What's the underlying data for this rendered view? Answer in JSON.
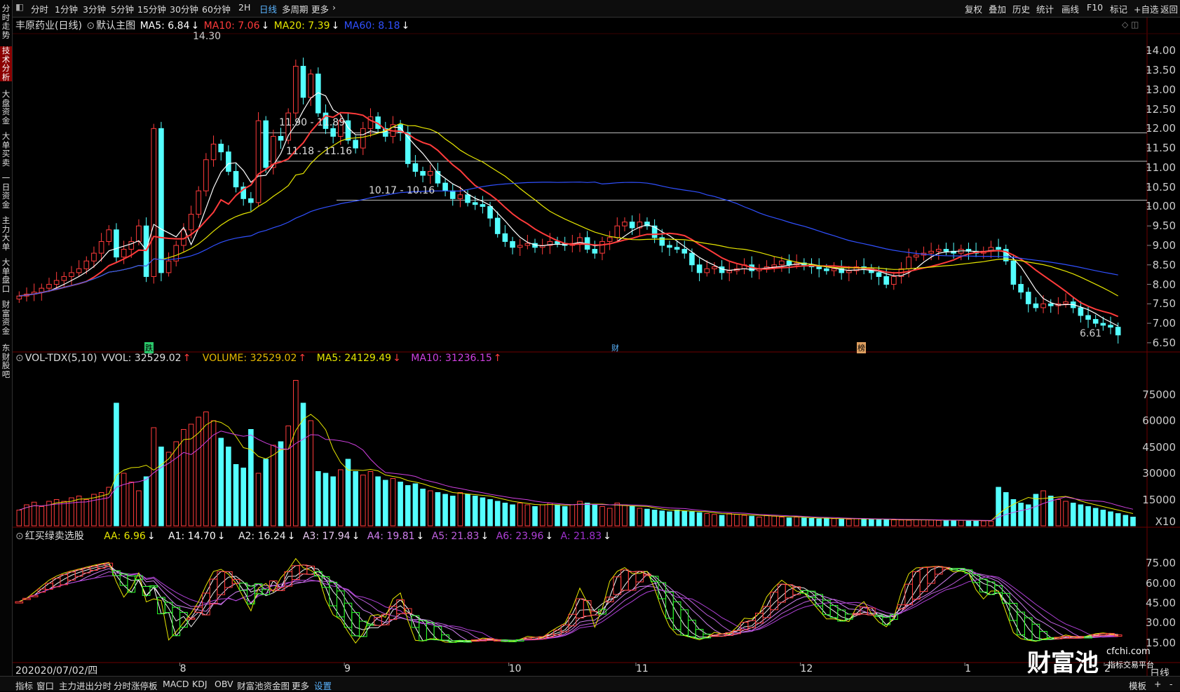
{
  "toolbar": {
    "periods": [
      "分时",
      "1分钟",
      "3分钟",
      "5分钟",
      "15分钟",
      "30分钟",
      "60分钟",
      "2H",
      "日线",
      "多周期",
      "更多"
    ],
    "active_period": "日线",
    "right_tools": [
      "复权",
      "叠加",
      "历史",
      "统计",
      "画线",
      "F10",
      "标记",
      "+自选",
      "返回"
    ]
  },
  "sidebar": {
    "tabs": [
      "分时走势",
      "技术分析",
      "大盘资金",
      "大单买卖",
      "一日资金",
      "主力大单",
      "大单盘口",
      "财富资金",
      "东财股吧"
    ],
    "active": "技术分析"
  },
  "main_header": {
    "title": "丰原药业(日线)",
    "template": "默认主图",
    "ma5": "MA5: 6.84",
    "ma10": "MA10: 7.06",
    "ma20": "MA20: 7.39",
    "ma60": "MA60: 8.18",
    "colors": {
      "ma5": "#ffffff",
      "ma10": "#ff3b3b",
      "ma20": "#e6e600",
      "ma60": "#3050ff"
    }
  },
  "price_axis": [
    "14.00",
    "13.50",
    "13.00",
    "12.50",
    "12.00",
    "11.50",
    "11.00",
    "10.50",
    "10.00",
    "9.50",
    "9.00",
    "8.50",
    "8.00",
    "7.50",
    "7.00",
    "6.50"
  ],
  "annotations": {
    "high": "14.30",
    "low": "6.61",
    "levels": [
      "11.90 - 11.89",
      "11.18 - 11.16",
      "10.17 - 10.16"
    ],
    "markers": [
      "跌",
      "财",
      "榜"
    ]
  },
  "volume_header": {
    "name": "VOL-TDX(5,10)",
    "vvol": "VVOL: 32529.02",
    "volume": "VOLUME: 32529.02",
    "ma5": "MA5: 24129.49",
    "ma10": "MA10: 31236.15"
  },
  "volume_axis": [
    "75000",
    "60000",
    "45000",
    "30000",
    "15000",
    "X10"
  ],
  "indicator_header": {
    "name": "红买绿卖选股",
    "aa": "AA: 6.96",
    "a1": "A1: 14.70",
    "a2": "A2: 16.24",
    "a3": "A3: 17.94",
    "a4": "A4: 19.81",
    "a5": "A5: 21.83",
    "a6": "A6: 23.96",
    "a": "A: 21.83"
  },
  "indicator_axis": [
    "75.00",
    "60.00",
    "45.00",
    "30.00",
    "15.00"
  ],
  "date_axis": {
    "start": "2020/07/02/四",
    "months": [
      "8",
      "9",
      "10",
      "11",
      "12",
      "1",
      "2"
    ]
  },
  "watermark": {
    "brand": "财富池",
    "url": "cfchi.com",
    "tagline": "指标交易平台"
  },
  "bottom_tabs": [
    "指标",
    "窗口",
    "主力进出分时",
    "分时涨停板",
    "MACD",
    "KDJ",
    "OBV",
    "财富池资金图",
    "更多",
    "设置"
  ],
  "bottom_right": [
    "模板",
    "+",
    "-"
  ],
  "period_label": "日线",
  "chart_data": {
    "type": "candlestick",
    "title": "丰原药业(日线)",
    "ylim": [
      6.3,
      14.4
    ],
    "month_ticks": [
      "8",
      "9",
      "10",
      "11",
      "12",
      "1",
      "2"
    ],
    "close": [
      7.7,
      7.75,
      7.8,
      7.9,
      8.0,
      8.1,
      8.2,
      8.3,
      8.4,
      8.6,
      8.8,
      9.1,
      9.4,
      8.7,
      8.9,
      9.1,
      9.5,
      8.2,
      12.0,
      8.3,
      8.6,
      9.0,
      9.4,
      9.8,
      10.4,
      11.2,
      11.6,
      11.4,
      10.9,
      10.5,
      10.2,
      10.1,
      12.2,
      11.0,
      11.8,
      11.7,
      12.4,
      13.6,
      12.8,
      13.4,
      12.4,
      12.0,
      11.8,
      12.2,
      11.7,
      11.5,
      12.0,
      12.3,
      12.0,
      11.8,
      12.1,
      11.9,
      11.1,
      10.9,
      10.8,
      10.9,
      10.6,
      10.4,
      10.2,
      10.3,
      10.1,
      10.05,
      10.0,
      9.7,
      9.3,
      9.1,
      8.95,
      9.0,
      9.05,
      8.95,
      9.0,
      9.1,
      9.05,
      9.0,
      9.05,
      9.2,
      8.9,
      8.8,
      9.1,
      9.2,
      9.5,
      9.6,
      9.45,
      9.6,
      9.5,
      9.2,
      9.0,
      8.95,
      8.9,
      8.8,
      8.5,
      8.3,
      8.4,
      8.45,
      8.3,
      8.35,
      8.4,
      8.5,
      8.35,
      8.4,
      8.45,
      8.5,
      8.6,
      8.5,
      8.55,
      8.5,
      8.45,
      8.4,
      8.35,
      8.4,
      8.3,
      8.35,
      8.45,
      8.4,
      8.3,
      8.2,
      8.0,
      8.2,
      8.4,
      8.7,
      8.75,
      8.8,
      8.85,
      8.9,
      8.85,
      8.8,
      8.9,
      8.85,
      8.8,
      8.85,
      8.95,
      8.9,
      8.6,
      8.0,
      7.8,
      7.5,
      7.4,
      7.5,
      7.45,
      7.5,
      7.55,
      7.4,
      7.2,
      7.1,
      7.0,
      6.95,
      6.9,
      6.7
    ],
    "volume": [
      9000,
      12000,
      13500,
      11000,
      14000,
      15000,
      14000,
      16000,
      17000,
      15000,
      18000,
      19000,
      22000,
      70000,
      30000,
      25000,
      20000,
      28000,
      56000,
      45000,
      42000,
      48000,
      55000,
      58000,
      62000,
      65000,
      60000,
      50000,
      45000,
      35000,
      33000,
      55000,
      30000,
      38000,
      46000,
      48000,
      57000,
      83000,
      70000,
      60000,
      31000,
      30000,
      28000,
      32000,
      38000,
      31000,
      29000,
      31000,
      28000,
      26000,
      27000,
      25000,
      23000,
      24000,
      21000,
      20000,
      19000,
      18000,
      17000,
      19000,
      18000,
      17000,
      16000,
      15000,
      14000,
      13000,
      12000,
      13000,
      12000,
      11000,
      12000,
      13000,
      12000,
      11000,
      12000,
      14000,
      13000,
      12000,
      11000,
      10000,
      13000,
      12000,
      11000,
      10000,
      9500,
      9000,
      8500,
      8000,
      9000,
      8500,
      8000,
      7500,
      7000,
      6500,
      6000,
      7000,
      6500,
      6000,
      5500,
      5000,
      6000,
      5500,
      5000,
      4500,
      5000,
      4500,
      4200,
      4000,
      4300,
      4100,
      4000,
      3800,
      4000,
      3900,
      3700,
      3500,
      3600,
      3400,
      3300,
      3200,
      3500,
      3400,
      3300,
      3100,
      3000,
      3200,
      3100,
      3000,
      2900,
      2800,
      2700,
      22000,
      19000,
      15000,
      13000,
      12000,
      18000,
      20000,
      17000,
      15000,
      14000,
      13000,
      12000,
      11000,
      10000,
      9000,
      8000,
      7000,
      6000,
      5000
    ],
    "series": [
      {
        "name": "MA5",
        "color": "#ffffff"
      },
      {
        "name": "MA10",
        "color": "#ff3b3b"
      },
      {
        "name": "MA20",
        "color": "#e6e600"
      },
      {
        "name": "MA60",
        "color": "#3050ff"
      }
    ]
  }
}
